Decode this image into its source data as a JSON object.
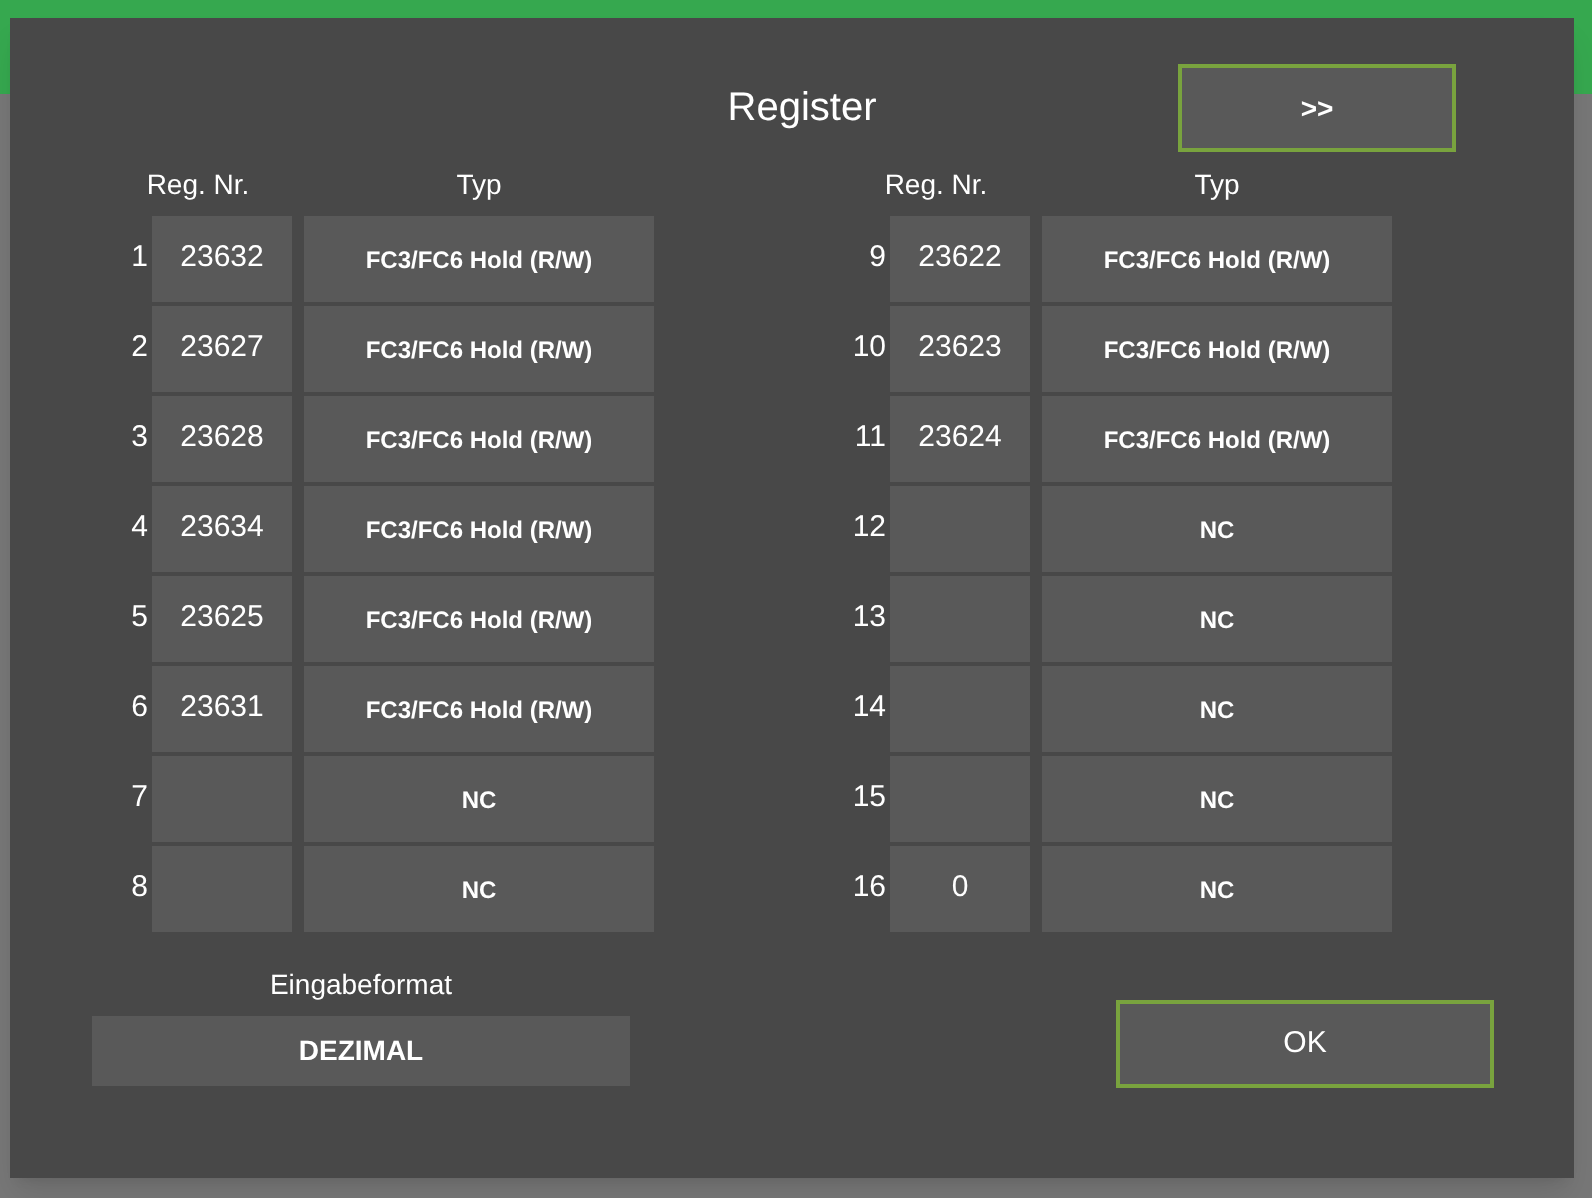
{
  "dialog": {
    "title": "Register",
    "next_button": ">>"
  },
  "columns": [
    {
      "number_header": "Reg. Nr.",
      "type_header": "Typ"
    },
    {
      "number_header": "Reg. Nr.",
      "type_header": "Typ"
    }
  ],
  "registers": [
    {
      "index": "1",
      "reg": "23632",
      "type": "FC3/FC6 Hold (R/W)"
    },
    {
      "index": "2",
      "reg": "23627",
      "type": "FC3/FC6 Hold (R/W)"
    },
    {
      "index": "3",
      "reg": "23628",
      "type": "FC3/FC6 Hold (R/W)"
    },
    {
      "index": "4",
      "reg": "23634",
      "type": "FC3/FC6 Hold (R/W)"
    },
    {
      "index": "5",
      "reg": "23625",
      "type": "FC3/FC6 Hold (R/W)"
    },
    {
      "index": "6",
      "reg": "23631",
      "type": "FC3/FC6 Hold (R/W)"
    },
    {
      "index": "7",
      "type": "NC"
    },
    {
      "index": "8",
      "type": "NC"
    },
    {
      "index": "9",
      "reg": "23622",
      "type": "FC3/FC6 Hold (R/W)"
    },
    {
      "index": "10",
      "reg": "23623",
      "type": "FC3/FC6 Hold (R/W)"
    },
    {
      "index": "11",
      "reg": "23624",
      "type": "FC3/FC6 Hold (R/W)"
    },
    {
      "index": "12",
      "type": "NC"
    },
    {
      "index": "13",
      "type": "NC"
    },
    {
      "index": "14",
      "type": "NC"
    },
    {
      "index": "15",
      "type": "NC"
    },
    {
      "index": "16",
      "reg": "0",
      "type": "NC"
    }
  ],
  "input_format": {
    "label": "Eingabeformat",
    "value": "DEZIMAL"
  },
  "ok_button": "OK"
}
